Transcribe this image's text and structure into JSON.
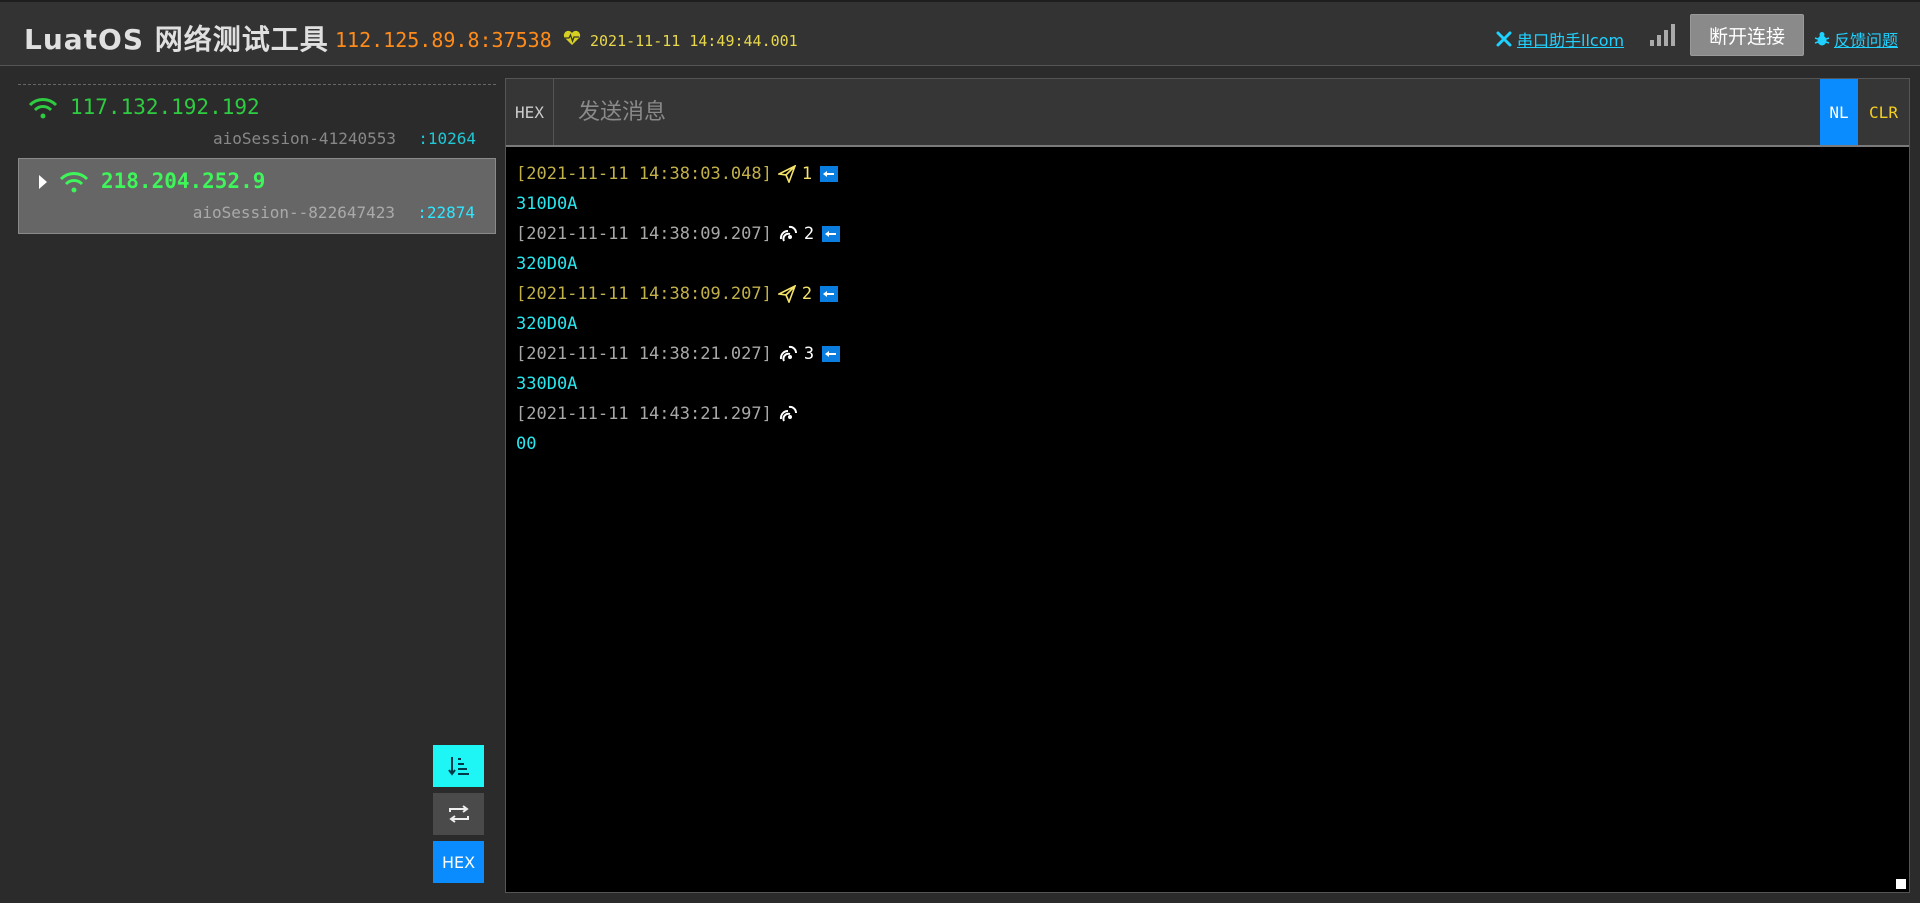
{
  "header": {
    "title": "LuatOS 网络测试工具",
    "server_addr": "112.125.89.8:37538",
    "heartbeat_time": "2021-11-11 14:49:44.001",
    "tool_link": "串口助手llcom",
    "disconnect_label": "断开连接",
    "feedback_link": "反馈问题"
  },
  "sessions": [
    {
      "ip": "117.132.192.192",
      "session_id": "aioSession-41240553",
      "port": ":10264",
      "active": false
    },
    {
      "ip": "218.204.252.9",
      "session_id": "aioSession--822647423",
      "port": ":22874",
      "active": true
    }
  ],
  "side_buttons": {
    "hex_label": "HEX"
  },
  "send": {
    "hex_label": "HEX",
    "placeholder": "发送消息",
    "nl_label": "NL",
    "clr_label": "CLR"
  },
  "log": [
    {
      "timestamp": "[2021-11-11 14:38:03.048]",
      "direction": "out",
      "seq": "1",
      "payload": "310D0A"
    },
    {
      "timestamp": "[2021-11-11 14:38:09.207]",
      "direction": "in",
      "seq": "2",
      "payload": "320D0A"
    },
    {
      "timestamp": "[2021-11-11 14:38:09.207]",
      "direction": "out",
      "seq": "2",
      "payload": "320D0A"
    },
    {
      "timestamp": "[2021-11-11 14:38:21.027]",
      "direction": "in",
      "seq": "3",
      "payload": "330D0A"
    },
    {
      "timestamp": "[2021-11-11 14:43:21.297]",
      "direction": "in",
      "seq": "",
      "payload": "00"
    }
  ],
  "colors": {
    "accent_blue": "#0a8cff",
    "cyan": "#1ef5f5",
    "orange": "#ff8c1a",
    "green": "#2ecc40"
  }
}
